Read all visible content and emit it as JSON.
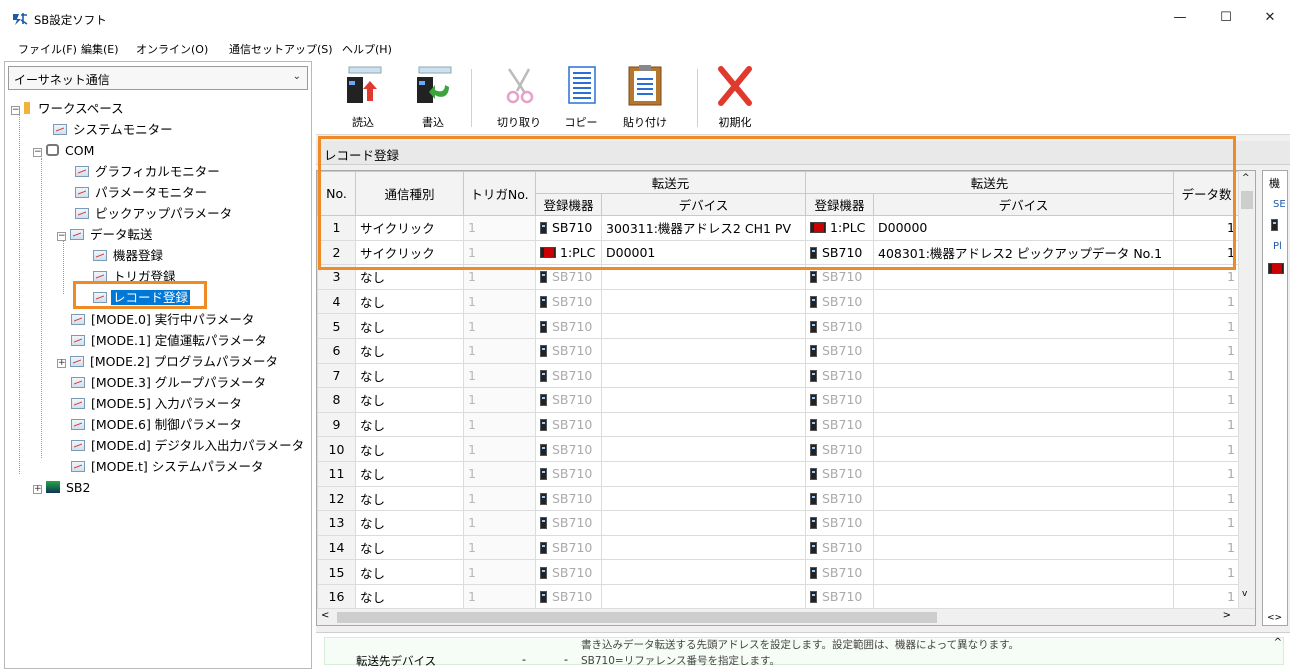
{
  "window": {
    "title": "SB設定ソフト",
    "minimize": "—",
    "maximize": "☐",
    "close": "✕"
  },
  "menu": [
    "ファイル(F)",
    "編集(E)",
    "オンライン(O)",
    "通信セットアップ(S)",
    "ヘルプ(H)"
  ],
  "sidebar": {
    "combo_value": "イーサネット通信",
    "tree": {
      "workspace": "ワークスペース",
      "system_monitor": "システムモニター",
      "com": "COM",
      "graphical_monitor": "グラフィカルモニター",
      "parameter_monitor": "パラメータモニター",
      "pickup_parameter": "ピックアップパラメータ",
      "data_transfer": "データ転送",
      "device_registration": "機器登録",
      "trigger_registration": "トリガ登録",
      "record_registration": "レコード登録",
      "mode0": "[MODE.0] 実行中パラメータ",
      "mode1": "[MODE.1] 定値運転パラメータ",
      "mode2": "[MODE.2] プログラムパラメータ",
      "mode3": "[MODE.3] グループパラメータ",
      "mode5": "[MODE.5] 入力パラメータ",
      "mode6": "[MODE.6] 制御パラメータ",
      "moded": "[MODE.d] デジタル入出力パラメータ",
      "modet": "[MODE.t] システムパラメータ",
      "sb2": "SB2"
    }
  },
  "toolbar": {
    "read": "読込",
    "write": "書込",
    "cut": "切り取り",
    "copy": "コピー",
    "paste": "貼り付け",
    "initialize": "初期化"
  },
  "section_title": "レコード登録",
  "table": {
    "headers": {
      "no": "No.",
      "comm_type": "通信種別",
      "trigger_no": "トリガNo.",
      "source": "転送元",
      "destination": "転送先",
      "reg_device": "登録機器",
      "device": "デバイス",
      "data_count": "データ数"
    },
    "rows": [
      {
        "no": "1",
        "type": "サイクリック",
        "trig": "1",
        "src_dev": "SB710",
        "src_addr": "300311:機器アドレス2 CH1 PV",
        "dst_dev": "1:PLC",
        "dst_addr": "D00000",
        "count": "1"
      },
      {
        "no": "2",
        "type": "サイクリック",
        "trig": "1",
        "src_dev": "1:PLC",
        "src_addr": "D00001",
        "dst_dev": "SB710",
        "dst_addr": "408301:機器アドレス2 ピックアップデータ No.1",
        "count": "1"
      },
      {
        "no": "3",
        "type": "なし",
        "trig": "1",
        "src_dev": "SB710",
        "src_addr": "",
        "dst_dev": "SB710",
        "dst_addr": "",
        "count": "1"
      },
      {
        "no": "4",
        "type": "なし",
        "trig": "1",
        "src_dev": "SB710",
        "src_addr": "",
        "dst_dev": "SB710",
        "dst_addr": "",
        "count": "1"
      },
      {
        "no": "5",
        "type": "なし",
        "trig": "1",
        "src_dev": "SB710",
        "src_addr": "",
        "dst_dev": "SB710",
        "dst_addr": "",
        "count": "1"
      },
      {
        "no": "6",
        "type": "なし",
        "trig": "1",
        "src_dev": "SB710",
        "src_addr": "",
        "dst_dev": "SB710",
        "dst_addr": "",
        "count": "1"
      },
      {
        "no": "7",
        "type": "なし",
        "trig": "1",
        "src_dev": "SB710",
        "src_addr": "",
        "dst_dev": "SB710",
        "dst_addr": "",
        "count": "1"
      },
      {
        "no": "8",
        "type": "なし",
        "trig": "1",
        "src_dev": "SB710",
        "src_addr": "",
        "dst_dev": "SB710",
        "dst_addr": "",
        "count": "1"
      },
      {
        "no": "9",
        "type": "なし",
        "trig": "1",
        "src_dev": "SB710",
        "src_addr": "",
        "dst_dev": "SB710",
        "dst_addr": "",
        "count": "1"
      },
      {
        "no": "10",
        "type": "なし",
        "trig": "1",
        "src_dev": "SB710",
        "src_addr": "",
        "dst_dev": "SB710",
        "dst_addr": "",
        "count": "1"
      },
      {
        "no": "11",
        "type": "なし",
        "trig": "1",
        "src_dev": "SB710",
        "src_addr": "",
        "dst_dev": "SB710",
        "dst_addr": "",
        "count": "1"
      },
      {
        "no": "12",
        "type": "なし",
        "trig": "1",
        "src_dev": "SB710",
        "src_addr": "",
        "dst_dev": "SB710",
        "dst_addr": "",
        "count": "1"
      },
      {
        "no": "13",
        "type": "なし",
        "trig": "1",
        "src_dev": "SB710",
        "src_addr": "",
        "dst_dev": "SB710",
        "dst_addr": "",
        "count": "1"
      },
      {
        "no": "14",
        "type": "なし",
        "trig": "1",
        "src_dev": "SB710",
        "src_addr": "",
        "dst_dev": "SB710",
        "dst_addr": "",
        "count": "1"
      },
      {
        "no": "15",
        "type": "なし",
        "trig": "1",
        "src_dev": "SB710",
        "src_addr": "",
        "dst_dev": "SB710",
        "dst_addr": "",
        "count": "1"
      },
      {
        "no": "16",
        "type": "なし",
        "trig": "1",
        "src_dev": "SB710",
        "src_addr": "",
        "dst_dev": "SB710",
        "dst_addr": "",
        "count": "1"
      }
    ]
  },
  "side_panel": {
    "header": "機",
    "lines": [
      "SE",
      "Pl"
    ]
  },
  "bottom": {
    "name": "転送先デバイス",
    "col2": "-",
    "col3": "-",
    "desc1": "書き込みデータ転送する先頭アドレスを設定します。設定範囲は、機器によって異なります。",
    "desc2": "SB710=リファレンス番号を指定します。"
  },
  "colors": {
    "highlight": "#f08a24",
    "selection": "#0078d7"
  }
}
